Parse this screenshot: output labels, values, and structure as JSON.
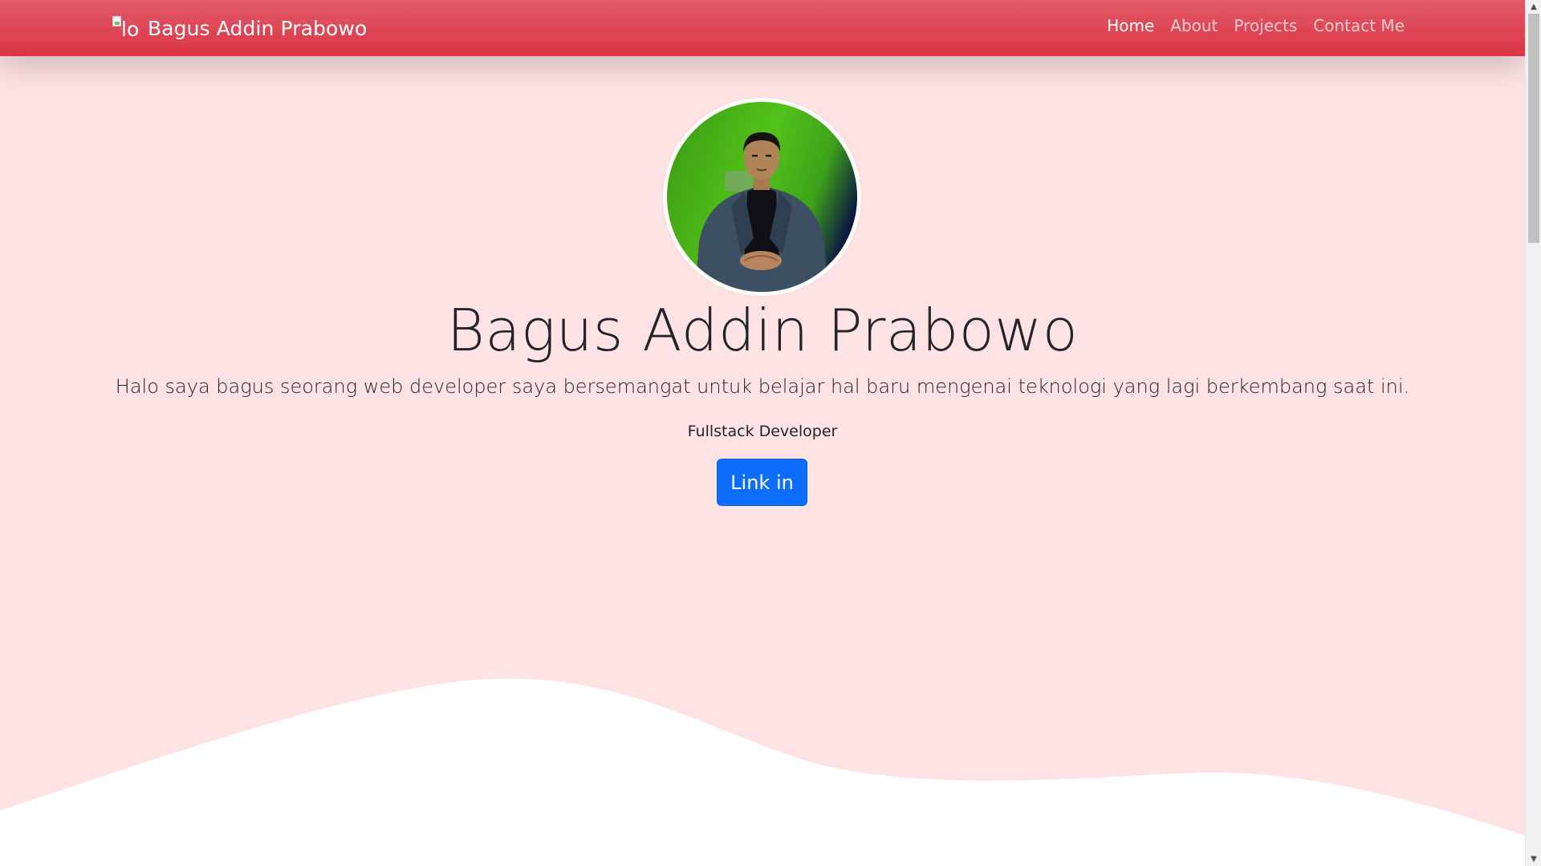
{
  "navbar": {
    "brand_alt": "lo",
    "brand_name": "Bagus Addin Prabowo",
    "links": [
      {
        "label": "Home",
        "active": true
      },
      {
        "label": "About",
        "active": false
      },
      {
        "label": "Projects",
        "active": false
      },
      {
        "label": "Contact Me",
        "active": false
      }
    ]
  },
  "hero": {
    "name": "Bagus Addin Prabowo",
    "lead": "Halo saya bagus seorang web developer saya bersemangat untuk belajar hal baru mengenai teknologi yang lagi berkembang saat ini.",
    "role": "Fullstack Developer",
    "button_label": "Link in"
  },
  "colors": {
    "navbar": "#dc3545",
    "background": "#ffe3e4",
    "button": "#0d6efd",
    "wave": "#ffffff"
  },
  "icons": {
    "scroll_up": "triangle-up-icon",
    "scroll_down": "triangle-down-icon",
    "broken_image": "broken-image-icon"
  }
}
